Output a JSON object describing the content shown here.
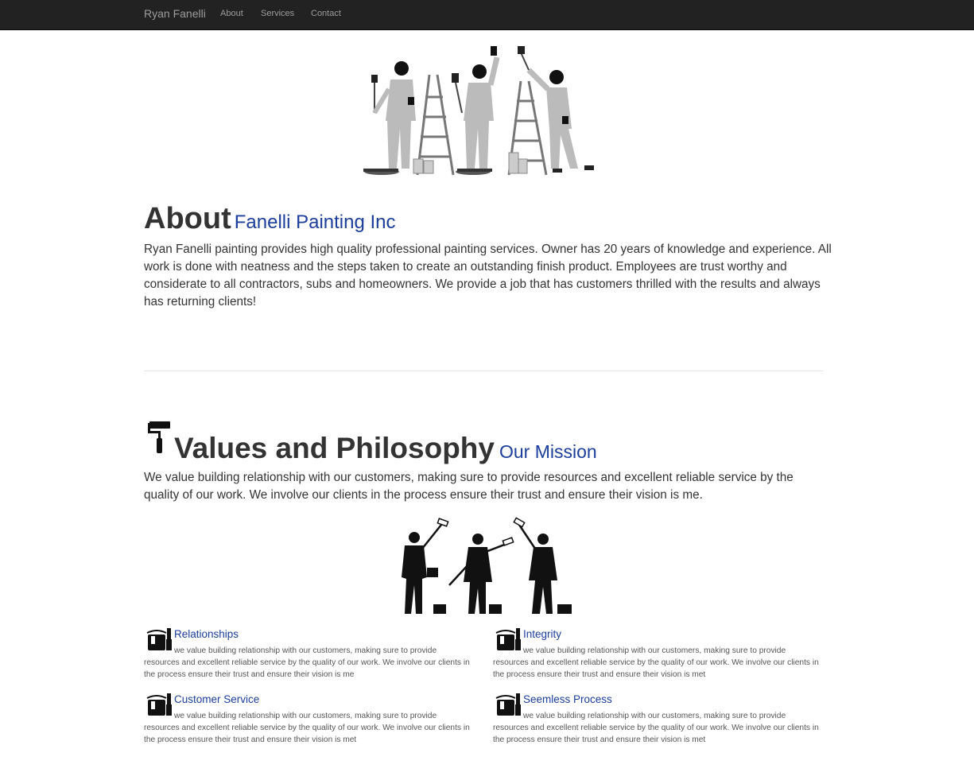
{
  "navbar": {
    "brand": "Ryan Fanelli",
    "links": [
      "About",
      "Services",
      "Contact"
    ]
  },
  "about": {
    "heading": "About",
    "subheading": "Fanelli Painting Inc",
    "text": "Ryan Fanelli painting provides high quality professional painting services. Owner has 20 years of knowledge and experience. All work is done with neatness and the steps taken to create an outstanding finish product. Employees are trust worthy and considerate to all contractors, subs and homeowners. We provide a job that has customers thrilled with the results and always has returning clients!"
  },
  "values": {
    "heading": "Values and Philosophy",
    "subheading": "Our Mission",
    "text": "We value building relationship with our customers, making sure to provide resources and excellent reliable service by the quality of our work. We involve our clients in the process ensure their trust and ensure their vision is me."
  },
  "features": [
    {
      "title": "Relationships",
      "body": "we value building relationship with our customers, making sure to provide resources and excellent reliable service by the quality of our work. We involve our clients in the process ensure their trust and ensure their vision is me"
    },
    {
      "title": "Integrity",
      "body": "we value building relationship with our customers, making sure to provide resources and excellent reliable service by the quality of our work. We involve our clients in the process ensure their trust and ensure their vision is met"
    },
    {
      "title": "Customer Service",
      "body": "we value building relationship with our customers, making sure to provide resources and excellent reliable service by the quality of our work. We involve our clients in the process ensure their trust and ensure their vision is met"
    },
    {
      "title": "Seemless Process",
      "body": "we value building relationship with our customers, making sure to provide resources and excellent reliable service by the quality of our work. We involve our clients in the process ensure their trust and ensure their vision is met"
    }
  ],
  "colors": {
    "navbar_bg": "#222222",
    "nav_text": "#9d9d9d",
    "accent_blue": "#1b3e9c",
    "body_text": "#333333"
  },
  "icons": {
    "hero": "painters-with-ladders-illustration",
    "values": "paint-roller-icon",
    "painters": "painters-silhouette-illustration",
    "feature": "paint-bucket-brush-icon"
  }
}
